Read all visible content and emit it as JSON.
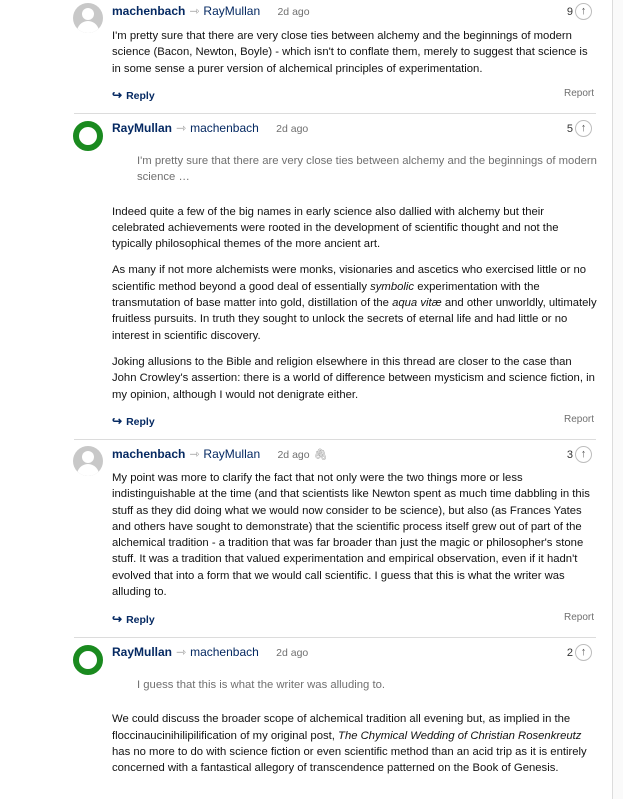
{
  "comments": [
    {
      "author": "machenbach",
      "recipient": "RayMullan",
      "time": "2d ago",
      "votes": "9",
      "paragraphs": [
        "I'm pretty sure that there are very close ties between alchemy and the beginnings of modern science (Bacon, Newton, Boyle) - which isn't to conflate them, merely to suggest that science is in some sense a purer version of alchemical principles of experimentation."
      ],
      "reply_label": "Reply",
      "report_label": "Report"
    },
    {
      "author": "RayMullan",
      "recipient": "machenbach",
      "time": "2d ago",
      "votes": "5",
      "quote": "I'm pretty sure that there are very close ties between alchemy and the beginnings of modern science …",
      "paragraphs": [
        "Indeed quite a few of the big names in early science also dallied with alchemy but their celebrated achievements were rooted in the development of scientific thought and not the typically philosophical themes of the more ancient art.",
        "As many if not more alchemists were monks, visionaries and ascetics who exercised little or no scientific method beyond a good deal of essentially",
        "symbolic",
        "experimentation with the transmutation of base matter into gold, distillation of the",
        "aqua vitæ",
        "and other unworldly, ultimately fruitless pursuits. In truth they sought to unlock the secrets of eternal life and had little or no interest in scientific discovery.",
        "Joking allusions to the Bible and religion elsewhere in this thread are closer to the case than John Crowley's assertion: there is a world of difference between mysticism and science fiction, in my opinion, although I would not denigrate either."
      ],
      "reply_label": "Reply",
      "report_label": "Report"
    },
    {
      "author": "machenbach",
      "recipient": "RayMullan",
      "time": "2d ago",
      "votes": "3",
      "paragraphs": [
        "My point was more to clarify the fact that not only were the two things more or less indistinguishable at the time (and that scientists like Newton spent as much time dabbling in this stuff as they did doing what we would now consider to be science), but also (as Frances Yates and others have sought to demonstrate) that the scientific process itself grew out of part of the alchemical tradition - a tradition that was far broader than just the magic or philosopher's stone stuff. It was a tradition that valued experimentation and empirical observation, even if it hadn't evolved that into a form that we would call scientific. I guess that this is what the writer was alluding to."
      ],
      "reply_label": "Reply",
      "report_label": "Report"
    },
    {
      "author": "RayMullan",
      "recipient": "machenbach",
      "time": "2d ago",
      "votes": "2",
      "quote": "I guess that this is what the writer was alluding to.",
      "paragraphs": [
        "We could discuss the broader scope of alchemical tradition all evening but, as implied in the floccinaucinihilipilification of my original post,",
        "The Chymical Wedding of Christian Rosenkreutz",
        "has no more to do with science fiction or even scientific method than an acid trip as it is entirely concerned with a fantastical allegory of transcendence patterned on the Book of Genesis."
      ]
    }
  ],
  "colors": {
    "link": "#052962",
    "avatar_green": "#1a8a1f",
    "avatar_grey": "#c8c8c8",
    "muted": "#707070"
  },
  "icons": {
    "reply_arrow": "reply-arrow-icon",
    "recommend": "recommend-arrow-icon",
    "connector": "reply-to-arrow-icon",
    "attachment": "paperclip-icon"
  }
}
